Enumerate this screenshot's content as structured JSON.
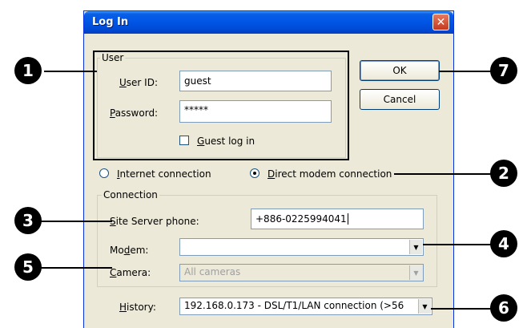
{
  "window": {
    "title": "Log In",
    "close_glyph": "✕"
  },
  "user_group": {
    "legend": "User",
    "user_id": {
      "label_prefix": "",
      "label_u": "U",
      "label_rest": "ser ID:",
      "value": "guest"
    },
    "password": {
      "label_u": "P",
      "label_rest": "assword:",
      "value": "*****"
    },
    "guest": {
      "label_u": "G",
      "label_rest": "uest log in",
      "checked": false
    }
  },
  "buttons": {
    "ok": "OK",
    "cancel": "Cancel"
  },
  "connection_type": {
    "internet": {
      "label_pre": "",
      "label_u": "I",
      "label_rest": "nternet connection",
      "selected": false
    },
    "direct": {
      "label_pre": "",
      "label_u": "D",
      "label_rest": "irect modem connection",
      "selected": true
    }
  },
  "connection_group": {
    "legend": "Connection",
    "site_phone": {
      "label_u": "S",
      "label_rest": "ite Server phone:",
      "value": "+886-0225994041"
    },
    "modem": {
      "label_pre": "Mo",
      "label_u": "d",
      "label_rest": "em:",
      "value": ""
    },
    "camera": {
      "label_u": "C",
      "label_rest": "amera:",
      "value": "All cameras"
    }
  },
  "history": {
    "label_u": "H",
    "label_rest": "istory:",
    "value": "192.168.0.173 - DSL/T1/LAN connection (>56"
  },
  "callouts": [
    "1",
    "2",
    "3",
    "4",
    "5",
    "6",
    "7"
  ],
  "colors": {
    "title_bar": "#0055e5",
    "dialog_bg": "#ece9d8",
    "close_button": "#c4391e"
  }
}
